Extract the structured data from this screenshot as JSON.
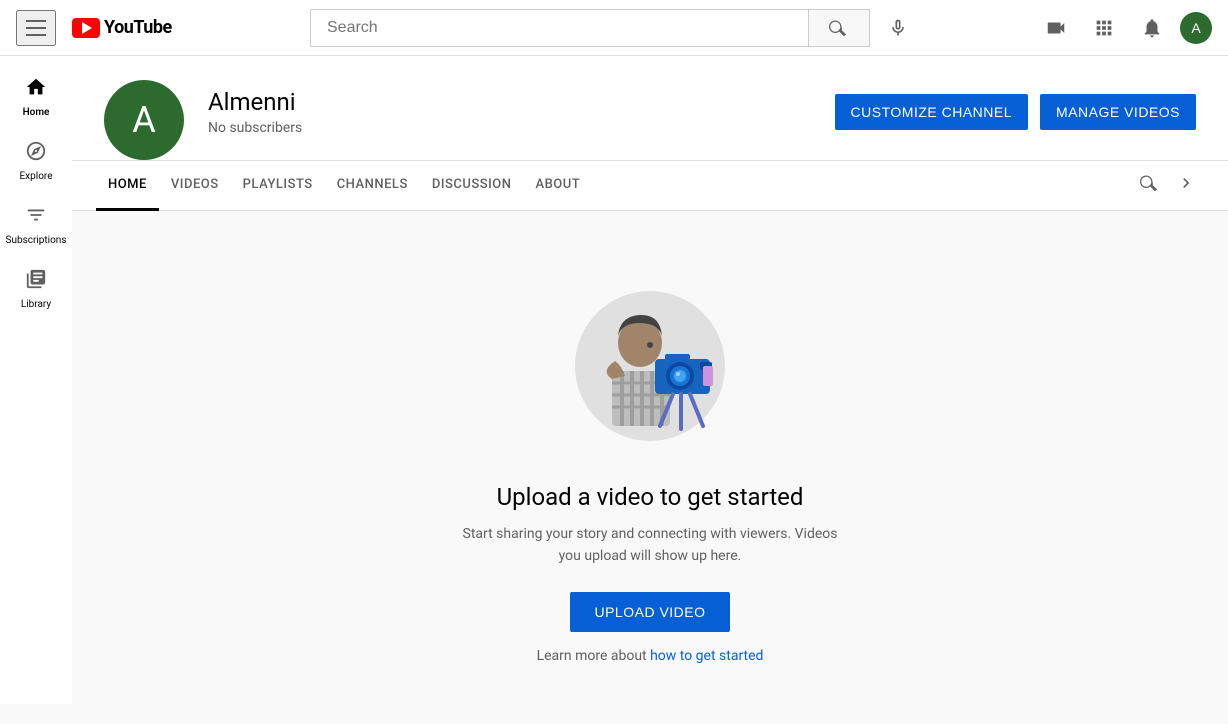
{
  "app": {
    "title": "YouTube"
  },
  "header": {
    "search_placeholder": "Search",
    "hamburger_label": "Menu"
  },
  "sidebar": {
    "items": [
      {
        "id": "home",
        "label": "Home",
        "icon": "⊞",
        "active": true
      },
      {
        "id": "explore",
        "label": "Explore",
        "icon": "◎",
        "active": false
      },
      {
        "id": "subscriptions",
        "label": "Subscriptions",
        "icon": "▤",
        "active": false
      },
      {
        "id": "library",
        "label": "Library",
        "icon": "◫",
        "active": false
      }
    ]
  },
  "channel": {
    "name": "Almenni",
    "avatar_letter": "A",
    "subscribers": "No subscribers",
    "customize_label": "CUSTOMIZE CHANNEL",
    "manage_label": "MANAGE VIDEOS"
  },
  "tabs": [
    {
      "id": "home",
      "label": "HOME",
      "active": true
    },
    {
      "id": "videos",
      "label": "VIDEOS",
      "active": false
    },
    {
      "id": "playlists",
      "label": "PLAYLISTS",
      "active": false
    },
    {
      "id": "channels",
      "label": "CHANNELS",
      "active": false
    },
    {
      "id": "discussion",
      "label": "DISCUSSION",
      "active": false
    },
    {
      "id": "about",
      "label": "ABOUT",
      "active": false
    }
  ],
  "empty_state": {
    "title": "Upload a video to get started",
    "description": "Start sharing your story and connecting with viewers. Videos you upload will show up here.",
    "upload_button": "UPLOAD VIDEO",
    "learn_prefix": "Learn more about ",
    "learn_link": "how to get started"
  }
}
